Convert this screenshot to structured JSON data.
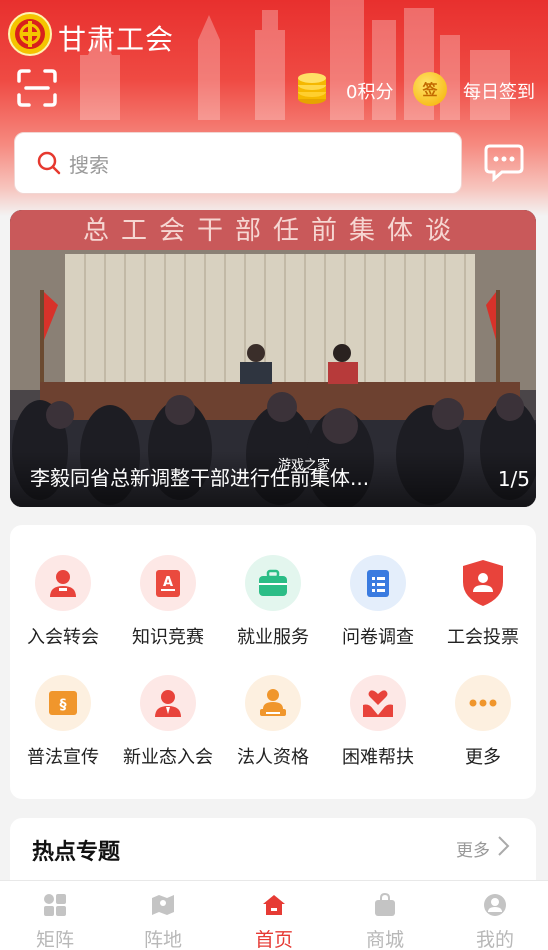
{
  "header": {
    "app_title": "甘肃工会",
    "points_label": "0积分",
    "sign_badge": "签",
    "sign_label": "每日签到"
  },
  "search": {
    "placeholder": "搜索"
  },
  "banner": {
    "headline_text": "总工会干部任前集体谈",
    "caption": "李毅同省总新调整干部进行任前集体...",
    "page_indicator": "1/5",
    "watermark": "游戏之家"
  },
  "services": [
    {
      "label": "入会转会",
      "icon": "person-join-icon",
      "color": "#e8433b",
      "bg": "#fde8e6"
    },
    {
      "label": "知识竞赛",
      "icon": "quiz-book-icon",
      "color": "#ea4a3e",
      "bg": "#fde8e6"
    },
    {
      "label": "就业服务",
      "icon": "briefcase-icon",
      "color": "#2bbd86",
      "bg": "#e3f6ee"
    },
    {
      "label": "问卷调查",
      "icon": "survey-list-icon",
      "color": "#3a7be0",
      "bg": "#e4eefb"
    },
    {
      "label": "工会投票",
      "icon": "vote-shield-icon",
      "color": "#e8433b",
      "bg": "#ffffff"
    },
    {
      "label": "普法宣传",
      "icon": "law-book-icon",
      "color": "#f0962c",
      "bg": "#fdf0e0"
    },
    {
      "label": "新业态入会",
      "icon": "new-member-icon",
      "color": "#e8433b",
      "bg": "#fde8e6"
    },
    {
      "label": "法人资格",
      "icon": "legal-person-icon",
      "color": "#f0962c",
      "bg": "#fdf0e0"
    },
    {
      "label": "困难帮扶",
      "icon": "helping-hand-icon",
      "color": "#e8433b",
      "bg": "#fde8e6"
    },
    {
      "label": "更多",
      "icon": "more-dots-icon",
      "color": "#f0962c",
      "bg": "#fdf0e0"
    }
  ],
  "hot_topics": {
    "title": "热点专题",
    "more_label": "更多"
  },
  "tabbar": [
    {
      "label": "矩阵",
      "icon": "matrix-icon",
      "active": false
    },
    {
      "label": "阵地",
      "icon": "map-icon",
      "active": false
    },
    {
      "label": "首页",
      "icon": "home-icon",
      "active": true
    },
    {
      "label": "商城",
      "icon": "shop-bag-icon",
      "active": false
    },
    {
      "label": "我的",
      "icon": "profile-icon",
      "active": false
    }
  ],
  "colors": {
    "brand_red": "#e8302e",
    "active_tab": "#e63b35",
    "inactive_tab": "#b8b8b8"
  }
}
